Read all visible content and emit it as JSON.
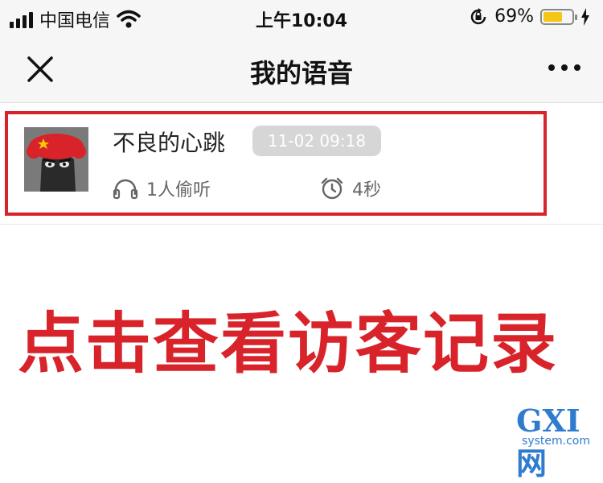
{
  "status_bar": {
    "carrier": "中国电信",
    "time": "上午10:04",
    "battery_percent_text": "69%",
    "battery_level": 0.69
  },
  "nav": {
    "title": "我的语音"
  },
  "voice_item": {
    "title": "不良的心跳",
    "timestamp": "11-02 09:18",
    "listeners": "1人偷听",
    "duration": "4秒"
  },
  "instruction": "点击查看访客记录",
  "watermark": {
    "main": "GXI网",
    "sub": "system.com"
  },
  "colors": {
    "highlight": "#d8232a",
    "badge_bg": "#d6d6d6",
    "battery": "#f5c518",
    "watermark": "#2f7ccf"
  }
}
